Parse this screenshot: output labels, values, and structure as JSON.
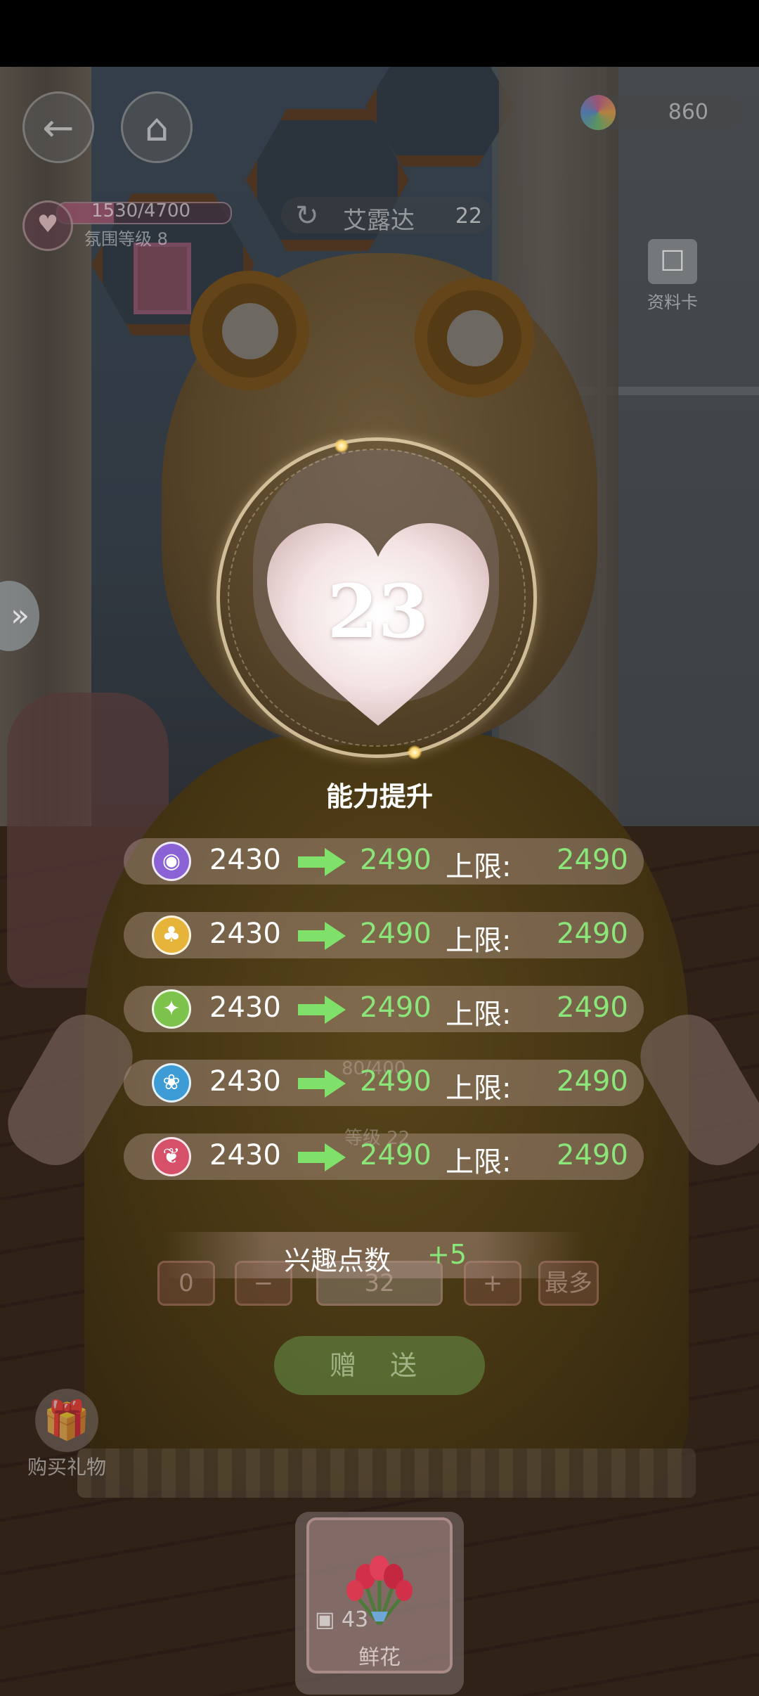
{
  "hud": {
    "currency_value": "860",
    "mood_progress": "1530/4700",
    "mood_fraction": 0.326,
    "mood_level": "氛围等级 8",
    "character_name": "艾露达",
    "affection_badge": "22",
    "profile_card_label": "资料卡",
    "icons": {
      "back": "back-arrow-icon",
      "home": "home-icon",
      "currency": "rainbow-gem-icon",
      "mood": "couple-icon",
      "swap": "swap-icon",
      "profile": "profile-card-icon",
      "side": "double-chevron-icon"
    }
  },
  "level_up": {
    "level": "23",
    "title": "能力提升",
    "cap_label": "上限:",
    "stats": [
      {
        "icon": "eye-icon",
        "color": "#8b62d6",
        "old": "2430",
        "new": "2490",
        "cap": "2490"
      },
      {
        "icon": "clover-icon",
        "color": "#e6b43a",
        "old": "2430",
        "new": "2490",
        "cap": "2490"
      },
      {
        "icon": "puzzle-icon",
        "color": "#7dc24a",
        "old": "2430",
        "new": "2490",
        "cap": "2490"
      },
      {
        "icon": "lightbulb-icon",
        "color": "#3d9bd6",
        "old": "2430",
        "new": "2490",
        "cap": "2490"
      },
      {
        "icon": "bow-icon",
        "color": "#d6506a",
        "old": "2430",
        "new": "2490",
        "cap": "2490"
      }
    ],
    "interest_label": "兴趣点数",
    "interest_value": "+5"
  },
  "gift_panel": {
    "faded_progress": "80/400",
    "faded_level": "等级 22",
    "qty_min": "0",
    "qty_minus": "−",
    "qty_value": "32",
    "qty_plus": "+",
    "qty_max": "最多",
    "give_button": "赠 送",
    "buy_gift_label": "购买礼物",
    "selected_gift": {
      "name": "鲜花",
      "count": "43"
    }
  },
  "colors": {
    "accent_green": "#8be67a",
    "white": "#ffffff"
  }
}
